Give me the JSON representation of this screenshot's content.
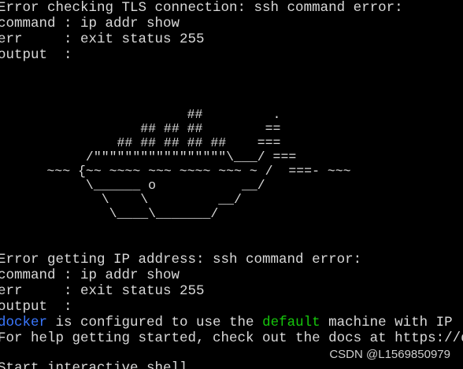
{
  "terminal": {
    "top_block": [
      "Error checking TLS connection: ssh command error:",
      "command : ip addr show",
      "err     : exit status 255",
      "output  :"
    ],
    "whale_art": [
      "                        ##         .",
      "                  ## ## ##        ==",
      "               ## ## ## ## ##    ===",
      "           /\"\"\"\"\"\"\"\"\"\"\"\"\"\"\"\"\"\\___/ ===",
      "      ~~~ {~~ ~~~~ ~~~ ~~~~ ~~~ ~ /  ===- ~~~",
      "           \\______ o           __/",
      "             \\    \\         __/",
      "              \\____\\_______/"
    ],
    "bottom_block": [
      "Error getting IP address: ssh command error:",
      "command : ip addr show",
      "err     : exit status 255",
      "output  :"
    ],
    "configured_line": {
      "word_docker": "docker",
      "middle": " is configured to use the ",
      "word_default": "default",
      "end": " machine with IP"
    },
    "help_line": "For help getting started, check out the docs at https://docs",
    "last_line": "Start interactive shell",
    "colors": {
      "background": "#000000",
      "text": "#d9d9d9",
      "docker_word": "#3b78ff",
      "default_word": "#16c60c"
    }
  },
  "watermark": "CSDN @L1569850979"
}
